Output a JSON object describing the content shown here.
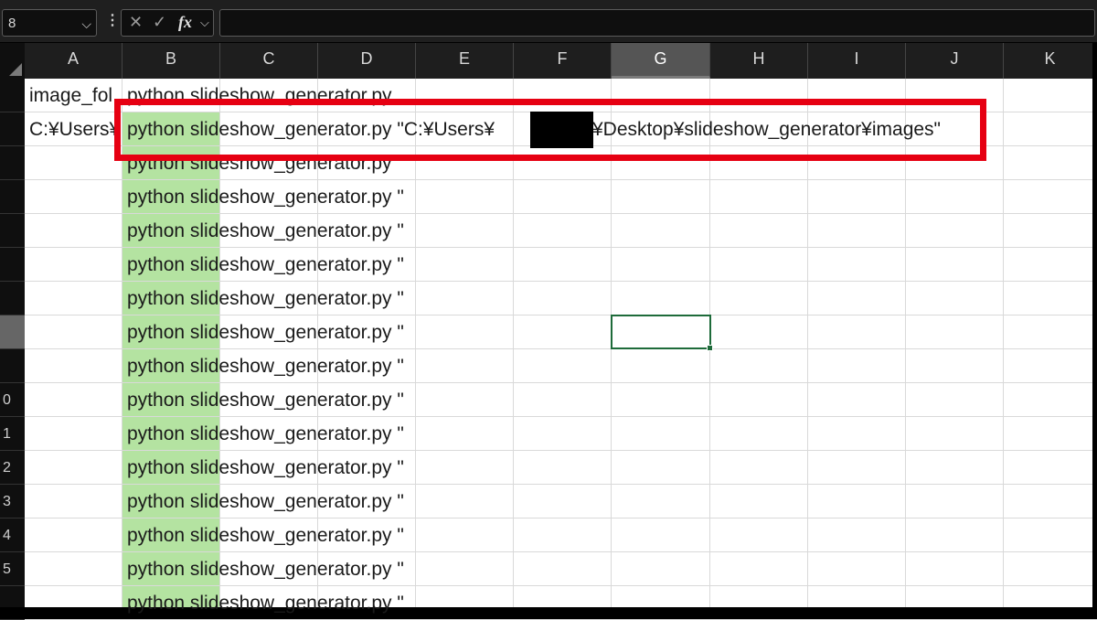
{
  "name_box": {
    "value": "8"
  },
  "formula_bar": {
    "value": "",
    "fx_label": "fx"
  },
  "columns": [
    "A",
    "B",
    "C",
    "D",
    "E",
    "F",
    "G",
    "H",
    "I",
    "J",
    "K"
  ],
  "selected_column": "G",
  "row_labels": [
    "",
    "",
    "",
    "",
    "",
    "",
    "",
    "",
    "",
    "0",
    "1",
    "2",
    "3",
    "4",
    "5",
    ""
  ],
  "cells": {
    "A1": "image_fol",
    "B1": "python slideshow_generator.py",
    "A2": "C:¥Users¥",
    "B2_prefix": "python slideshow_generator.py \"C:¥Users¥",
    "B2_suffix": "¥Desktop¥slideshow_generator¥images\"",
    "B_rest": [
      "python slideshow_generator.py \"",
      "python slideshow_generator.py \"",
      "python slideshow_generator.py \"",
      "python slideshow_generator.py \"",
      "python slideshow_generator.py \"",
      "python slideshow_generator.py \"",
      "python slideshow_generator.py \"",
      "python slideshow_generator.py \"",
      "python slideshow_generator.py \"",
      "python slideshow_generator.py \"",
      "python slideshow_generator.py \"",
      "python slideshow_generator.py \"",
      "python slideshow_generator.py \"",
      "python slideshow_generator.py \""
    ]
  },
  "colors": {
    "highlight_green": "#b4e3a1",
    "annotation_red": "#e60012",
    "active_border": "#1e6b3a"
  }
}
